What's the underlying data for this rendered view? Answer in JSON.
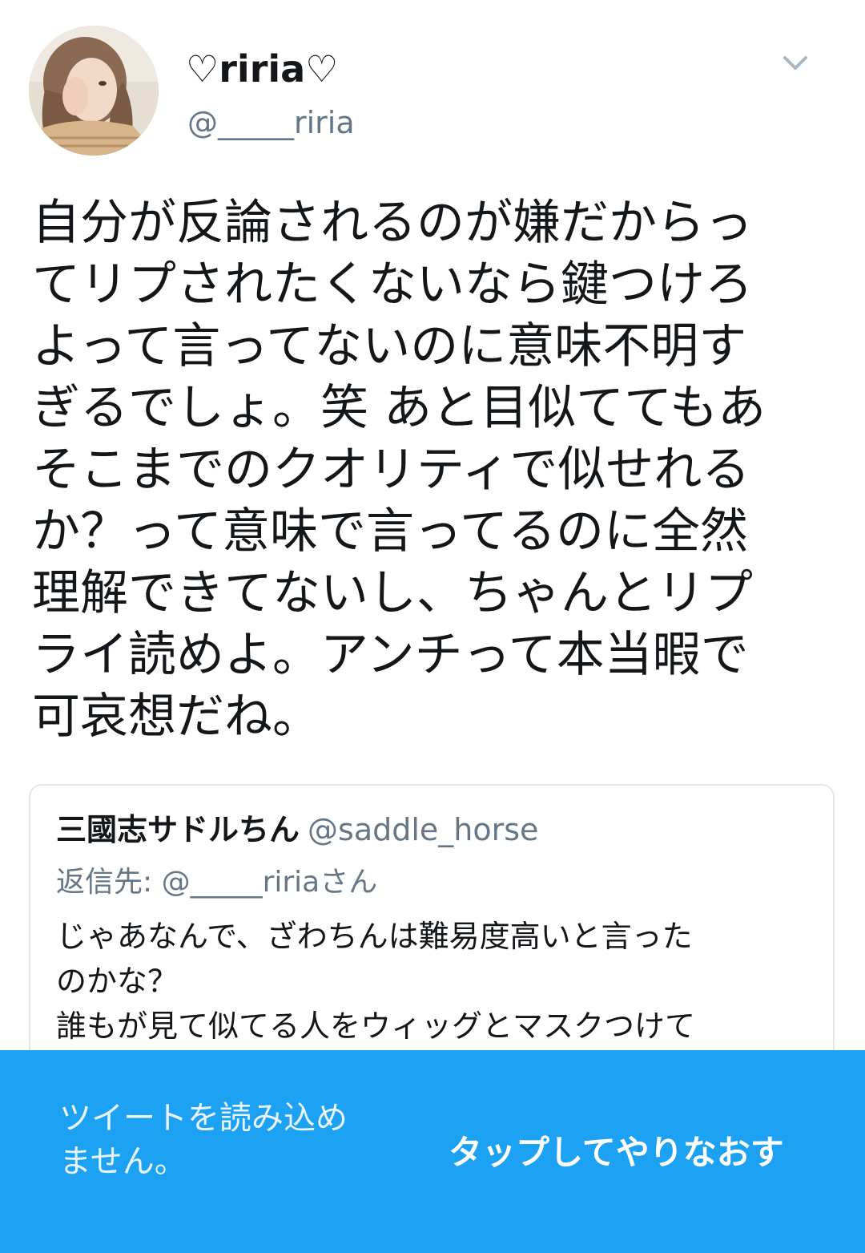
{
  "tweet": {
    "display_name": "♡riria♡",
    "handle": "@_____riria",
    "avatar_icon": "profile-photo",
    "menu_icon": "chevron-down-icon",
    "text": "自分が反論されるのが嫌だからっ\nてリプされたくないなら鍵つけろ\nよって言ってないのに意味不明す\nぎるでしょ。笑 あと目似ててもあ\nそこまでのクオリティで似せれる\nか？って意味で言ってるのに全然\n理解できてないし、ちゃんとリプ\nライ読めよ。アンチって本当暇で\n可哀想だね。"
  },
  "quoted_tweet": {
    "name": "三國志サドルちん",
    "handle": "@saddle_horse",
    "replying_to": "返信先: @_____ririaさん",
    "text": "じゃあなんで、ざわちんは難易度高いと言った\nのかな？\n誰もが見て似てる人をウィッグとマスクつけて"
  },
  "error_banner": {
    "message": "ツイートを読み込め\nません。",
    "retry_label": "タップしてやりなおす",
    "background_color": "#1da1f2"
  },
  "colors": {
    "text_primary": "#14171a",
    "text_secondary": "#657786",
    "border": "#e1e8ed"
  }
}
